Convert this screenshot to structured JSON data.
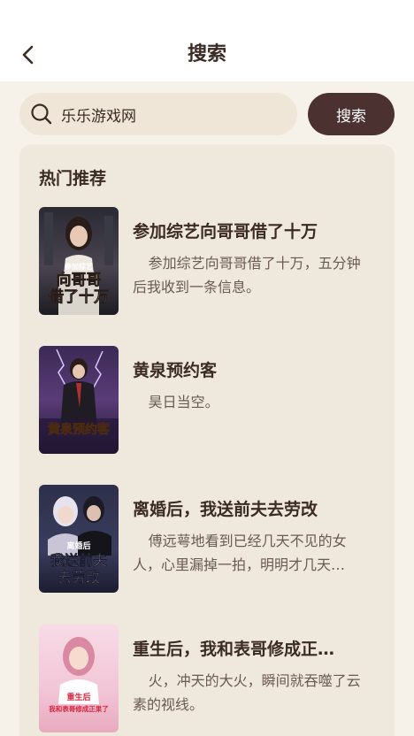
{
  "header": {
    "title": "搜索",
    "back_icon": "chevron-left-icon"
  },
  "search": {
    "value": "乐乐游戏网",
    "button_label": "搜索",
    "icon": "search-icon"
  },
  "recommend": {
    "title": "热门推荐",
    "books": [
      {
        "title": "参加综艺向哥哥借了十万",
        "desc": "参加综艺向哥哥借了十万，五分钟后我收到一条信息。",
        "cover_lines": [
          "参加综艺",
          "向哥哥",
          "借了十万"
        ]
      },
      {
        "title": "黄泉预约客",
        "desc": "昊日当空。",
        "cover_lines": [
          "黄泉预约客"
        ]
      },
      {
        "title": "离婚后，我送前夫去劳改",
        "desc": "傅远萼地看到已经几天不见的女人，心里漏掉一拍，明明才几天…",
        "cover_lines": [
          "离婚后",
          "我送前夫",
          "去劳改"
        ]
      },
      {
        "title": "重生后，我和表哥修成正…",
        "desc": "火，冲天的大火，瞬间就吞噬了云素的视线。",
        "cover_lines": [
          "重生后",
          "我和表哥修成正果了"
        ]
      }
    ]
  }
}
